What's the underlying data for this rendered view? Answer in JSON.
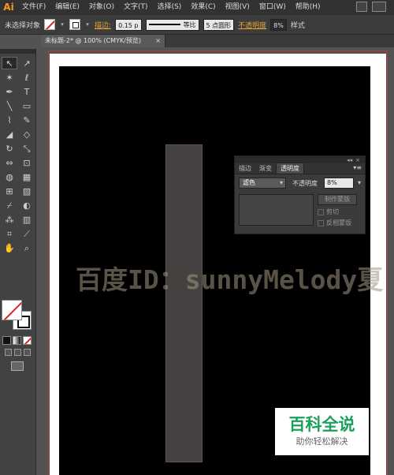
{
  "app": {
    "logo": "Ai"
  },
  "menu": [
    "文件(F)",
    "编辑(E)",
    "对象(O)",
    "文字(T)",
    "选择(S)",
    "效果(C)",
    "视图(V)",
    "窗口(W)",
    "帮助(H)"
  ],
  "control_bar": {
    "selection_label": "未选择对象",
    "stroke_link": "描边:",
    "stroke_width": "0.15 p",
    "stroke_profile": "等比",
    "brush": "5 点圆形",
    "opacity_link": "不透明度",
    "opacity_value": "8%",
    "style_label": "样式"
  },
  "document_tab": {
    "title": "未标题-2* @ 100% (CMYK/预览)",
    "close": "×"
  },
  "canvas": {
    "watermark": "百度ID：sunnyMelody夏"
  },
  "transparency_panel": {
    "collapse": "◂◂",
    "close": "×",
    "tabs": [
      "描边",
      "渐变",
      "透明度"
    ],
    "active_tab": "透明度",
    "menu": "▾≡",
    "blend_mode": "滤色",
    "opacity_label": "不透明度",
    "opacity_value": "8%",
    "make_mask": "制作蒙版",
    "clip": "剪切",
    "invert_mask": "反相蒙版"
  },
  "baike_logo": {
    "title": "百科全说",
    "subtitle": "助你轻松解决"
  },
  "colors": {
    "menubar": "#323232",
    "accent_link": "#e8a23a",
    "ai_logo": "#f79a1c",
    "baike_green": "#1aa05a",
    "artwork_black": "#000000",
    "artwork_gray": "#454140"
  },
  "tools": [
    "selection-icon",
    "direct-selection-icon",
    "magic-wand-icon",
    "lasso-icon",
    "pen-icon",
    "type-icon",
    "line-icon",
    "rectangle-icon",
    "paintbrush-icon",
    "pencil-icon",
    "blob-brush-icon",
    "eraser-icon",
    "rotate-icon",
    "scale-icon",
    "width-icon",
    "free-transform-icon",
    "shape-builder-icon",
    "perspective-grid-icon",
    "mesh-icon",
    "gradient-icon",
    "eyedropper-icon",
    "blend-icon",
    "symbol-sprayer-icon",
    "column-graph-icon",
    "artboard-icon",
    "slice-icon",
    "hand-icon",
    "zoom-icon"
  ]
}
